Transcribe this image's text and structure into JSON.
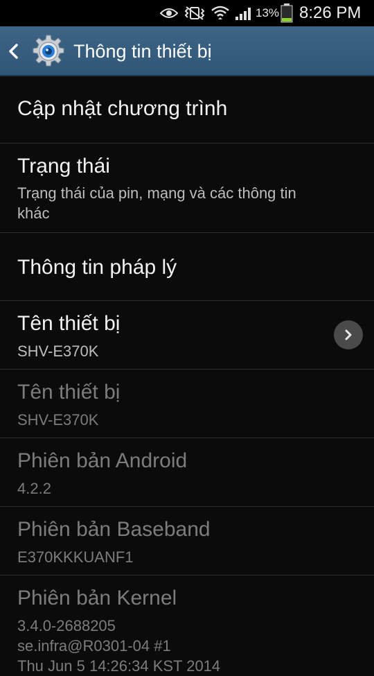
{
  "status_bar": {
    "battery_percent": "13%",
    "time": "8:26 PM",
    "icons": [
      "eye-icon",
      "no-vibrate-icon",
      "wifi-icon",
      "cell-signal-icon",
      "battery-icon"
    ]
  },
  "action_bar": {
    "title": "Thông tin thiết bị",
    "back_icon": "chevron-left-icon",
    "app_icon": "gear-icon"
  },
  "items": [
    {
      "title": "Cập nhật chương trình",
      "summary": "",
      "enabled": true
    },
    {
      "title": "Trạng thái",
      "summary": "Trạng thái của pin, mạng và các thông tin",
      "summary2": "khác",
      "enabled": true
    },
    {
      "title": "Thông tin pháp lý",
      "summary": "",
      "enabled": true
    },
    {
      "title": "Tên thiết bị",
      "summary": "SHV-E370K",
      "enabled": true,
      "has_chevron": true
    },
    {
      "title": "Tên thiết bị",
      "summary": "SHV-E370K",
      "enabled": false
    },
    {
      "title": "Phiên bản Android",
      "summary": "4.2.2",
      "enabled": false
    },
    {
      "title": "Phiên bản Baseband",
      "summary": "E370KKKUANF1",
      "enabled": false
    },
    {
      "title": "Phiên bản Kernel",
      "summary": "3.4.0-2688205",
      "summary2": "se.infra@R0301-04 #1",
      "summary3": "Thu Jun 5 14:26:34 KST 2014",
      "enabled": false
    }
  ],
  "colors": {
    "background": "#0b0b0b",
    "action_bar": "#34597b",
    "divider": "#2e2e2e",
    "disabled_text": "#7c7c7c"
  }
}
